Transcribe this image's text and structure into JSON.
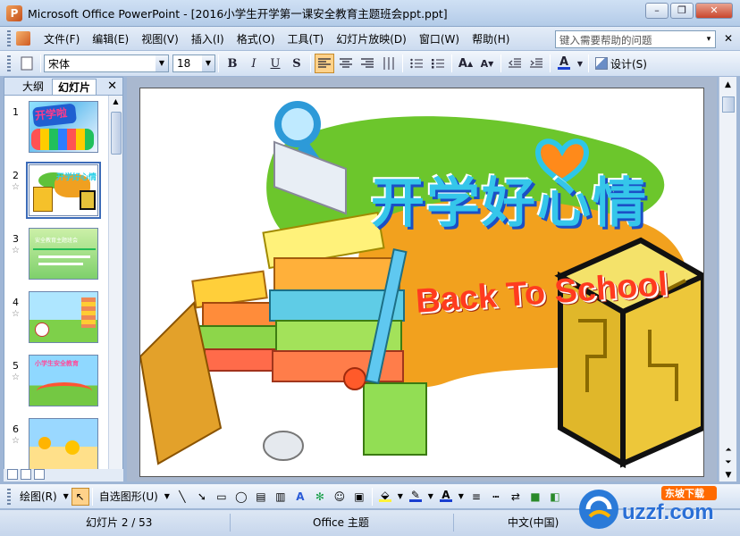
{
  "window": {
    "title": "Microsoft Office PowerPoint - [2016小学生开学第一课安全教育主题班会ppt.ppt]",
    "app_icon_letter": "P",
    "btn_minimize": "–",
    "btn_restore": "❐",
    "btn_close": "✕"
  },
  "menu": {
    "items": [
      "文件(F)",
      "编辑(E)",
      "视图(V)",
      "插入(I)",
      "格式(O)",
      "工具(T)",
      "幻灯片放映(D)",
      "窗口(W)",
      "帮助(H)"
    ],
    "help_placeholder": "键入需要帮助的问题",
    "help_dropdown": "▾",
    "close": "✕"
  },
  "format_toolbar": {
    "font_name": "宋体",
    "font_size": "18",
    "bold": "B",
    "italic": "I",
    "underline": "U",
    "shadow": "S",
    "design_label": "设计(S)"
  },
  "panes": {
    "tab_outline": "大纲",
    "tab_slides": "幻灯片",
    "close": "✕",
    "thumbnails": [
      {
        "num": "1",
        "star": ""
      },
      {
        "num": "2",
        "star": "☆"
      },
      {
        "num": "3",
        "star": "☆"
      },
      {
        "num": "4",
        "star": "☆"
      },
      {
        "num": "5",
        "star": "☆"
      },
      {
        "num": "6",
        "star": "☆"
      }
    ],
    "thumb1_text": "开学啦",
    "thumb2_text": "开学好心情",
    "thumb3_text": "安全教育主题班会",
    "thumb5_text": "小学生安全教育"
  },
  "slide": {
    "title_cn": "开学好心情",
    "title_en": "Back To School"
  },
  "draw_toolbar": {
    "draw_label": "绘图(R)",
    "autoshape_label": "自选图形(U)"
  },
  "status": {
    "slide_pos": "幻灯片 2 / 53",
    "theme": "Office 主题",
    "language": "中文(中国)"
  },
  "watermark": {
    "text": "uzzf.com",
    "badge": "东坡下载"
  }
}
